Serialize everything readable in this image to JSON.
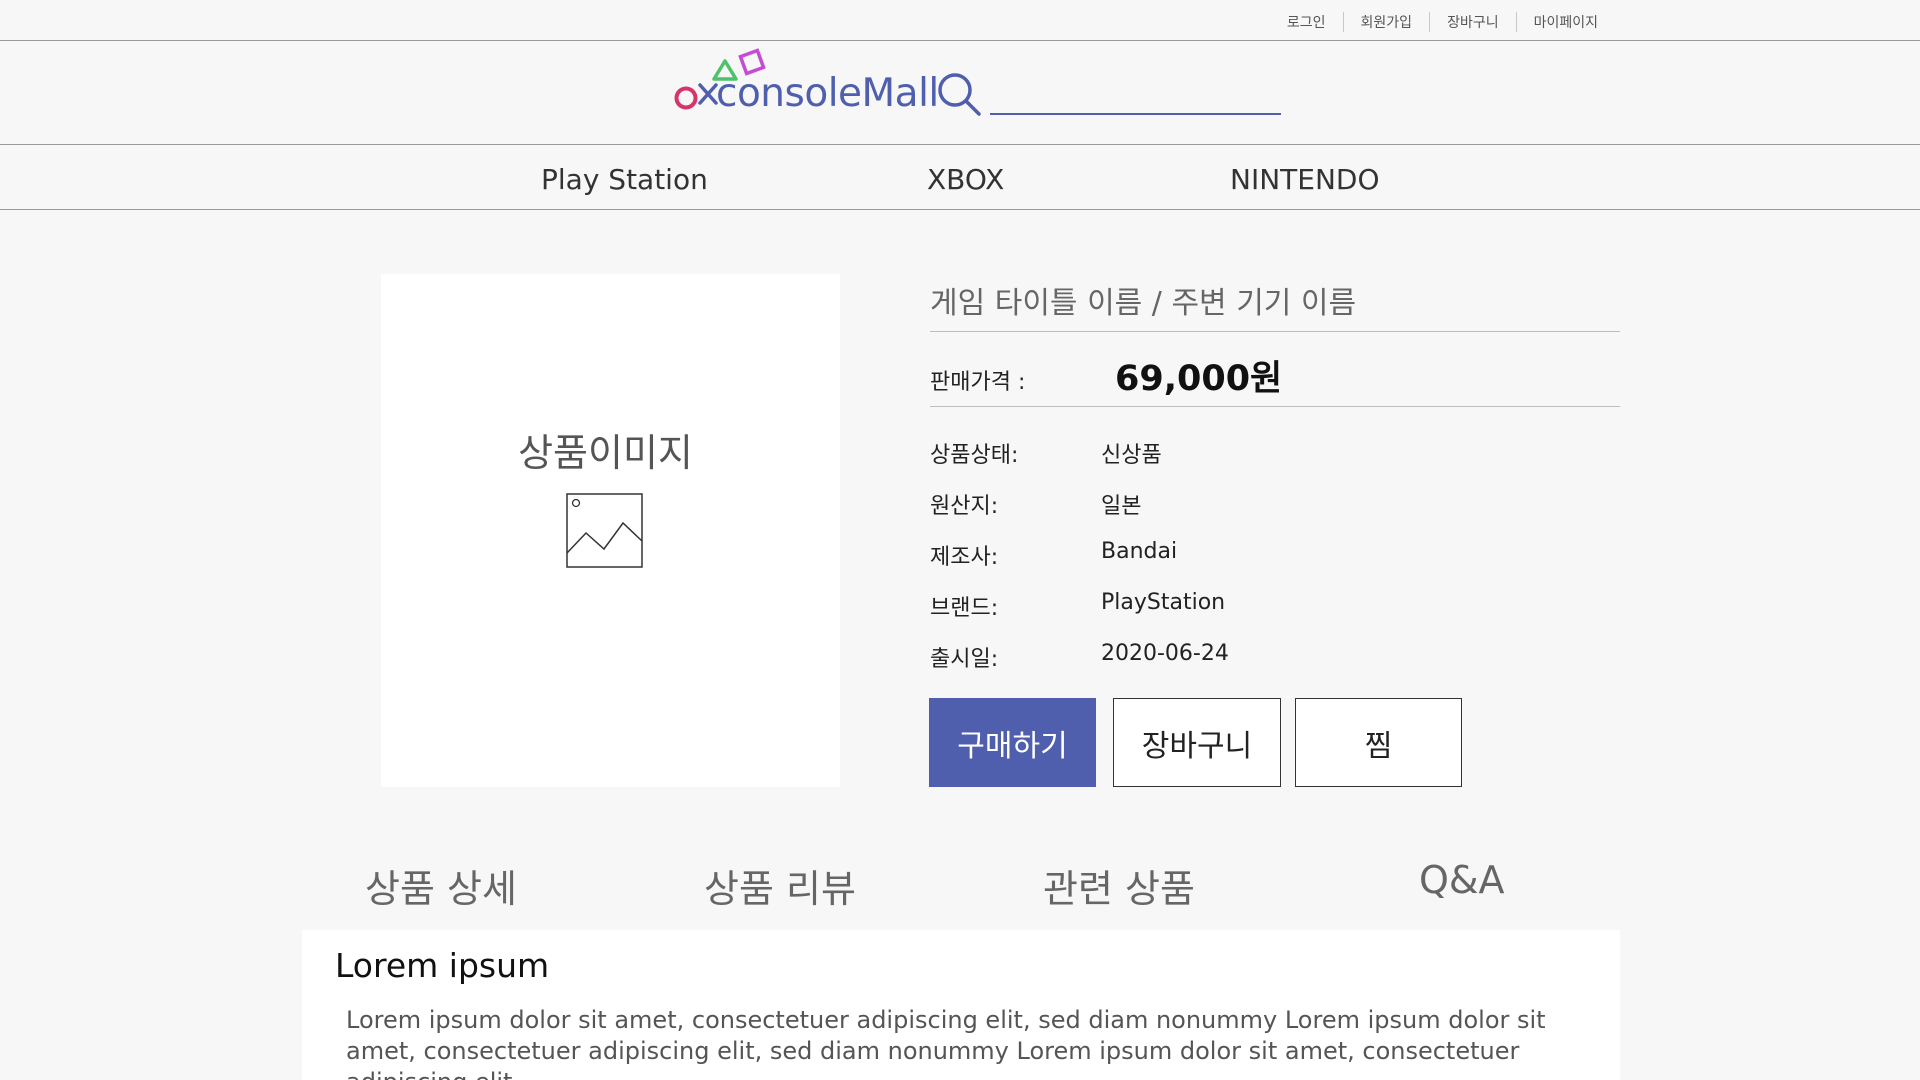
{
  "util_links": [
    "로그인",
    "회원가입",
    "장바구니",
    "마이페이지"
  ],
  "logo": {
    "text": "consoleMall"
  },
  "search": {
    "placeholder": ""
  },
  "categories": [
    "Play Station",
    "XBOX",
    "NINTENDO"
  ],
  "product": {
    "image_label": "상품이미지",
    "title": "게임 타이틀 이름 / 주변 기기 이름",
    "price_label": "판매가격 :",
    "price": "69,000원",
    "specs": [
      {
        "label": "상품상태:",
        "value": "신상품"
      },
      {
        "label": "원산지:",
        "value": "일본"
      },
      {
        "label": "제조사:",
        "value": "Bandai"
      },
      {
        "label": "브랜드:",
        "value": "PlayStation"
      },
      {
        "label": "출시일:",
        "value": "2020-06-24"
      }
    ],
    "buttons": {
      "buy": "구매하기",
      "cart": "장바구니",
      "wish": "찜"
    }
  },
  "tabs": [
    "상품 상세",
    "상품 리뷰",
    "관련 상품",
    "Q&A"
  ],
  "detail": {
    "heading": "Lorem ipsum",
    "body": "Lorem ipsum dolor sit amet, consectetuer adipiscing elit, sed diam nonummy Lorem ipsum dolor sit amet, consectetuer adipiscing elit, sed diam nonummy Lorem ipsum dolor sit amet, consectetuer adipiscing elit,"
  },
  "colors": {
    "accent": "#4f5fae",
    "logo_circle": "#d8336b",
    "logo_cross": "#4f5fae",
    "logo_triangle": "#4cc26a",
    "logo_square": "#c44bd6"
  },
  "icons": {
    "search": "search-icon",
    "image_placeholder": "image-placeholder-icon"
  }
}
